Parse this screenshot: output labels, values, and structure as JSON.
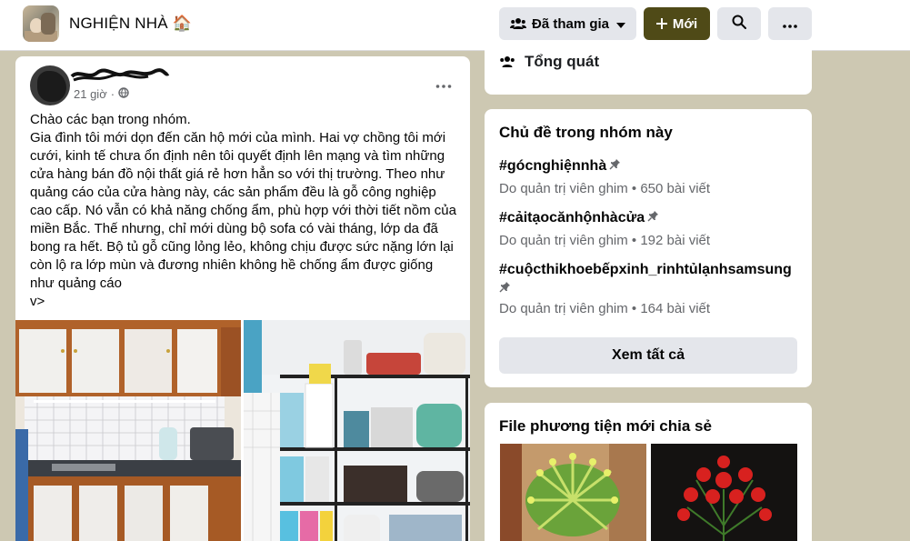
{
  "header": {
    "group_name": "NGHIỆN NHÀ 🏠",
    "joined_label": "Đã tham gia",
    "new_label": "Mới"
  },
  "post": {
    "time": "21 giờ",
    "text": "Chào các bạn trong nhóm.\nGia đình tôi mới dọn đến căn hộ mới của mình. Hai vợ chồng tôi mới cưới, kinh tế chưa ổn định nên tôi quyết định lên mạng và tìm những cửa hàng bán đồ nội thất giá rẻ hơn hẳn so với thị trường. Theo như quảng cáo của cửa hàng này, các sản phẩm đều là gỗ công nghiệp cao cấp. Nó vẫn có khả năng chống ẩm, phù hợp với thời tiết nồm của miền Bắc. Thế nhưng, chỉ mới dùng bộ sofa có vài tháng, lớp da đã bong ra hết. Bộ tủ gỗ cũng lỏng lẻo, không chịu được sức nặng lớn lại còn lộ ra lớp mùn và đương nhiên không hề chống ẩm được giống như quảng cáo\nv>"
  },
  "sidebar": {
    "general_label": "Tổng quát",
    "topics_title": "Chủ đề trong nhóm này",
    "topics": [
      {
        "name": "#gócnghiệnnhà",
        "meta": "Do quản trị viên ghim • 650 bài viết"
      },
      {
        "name": "#cảitạocănhộnhàcửa",
        "meta": "Do quản trị viên ghim • 192 bài viết"
      },
      {
        "name": "#cuộcthikhoebếpxinh_rinhtủlạnhsamsung",
        "meta": "Do quản trị viên ghim • 164 bài viết"
      }
    ],
    "see_all_label": "Xem tất cả",
    "media_title": "File phương tiện mới chia sẻ"
  },
  "colors": {
    "background": "#cdc8b2",
    "new_button": "#4f4a17",
    "secondary_button": "#e4e6eb",
    "muted_text": "#65676b"
  },
  "icons": {
    "joined": "people-icon",
    "new": "plus-icon",
    "search": "search-icon",
    "more": "more-horizontal-icon",
    "privacy": "globe-icon",
    "pinned": "pin-icon"
  }
}
